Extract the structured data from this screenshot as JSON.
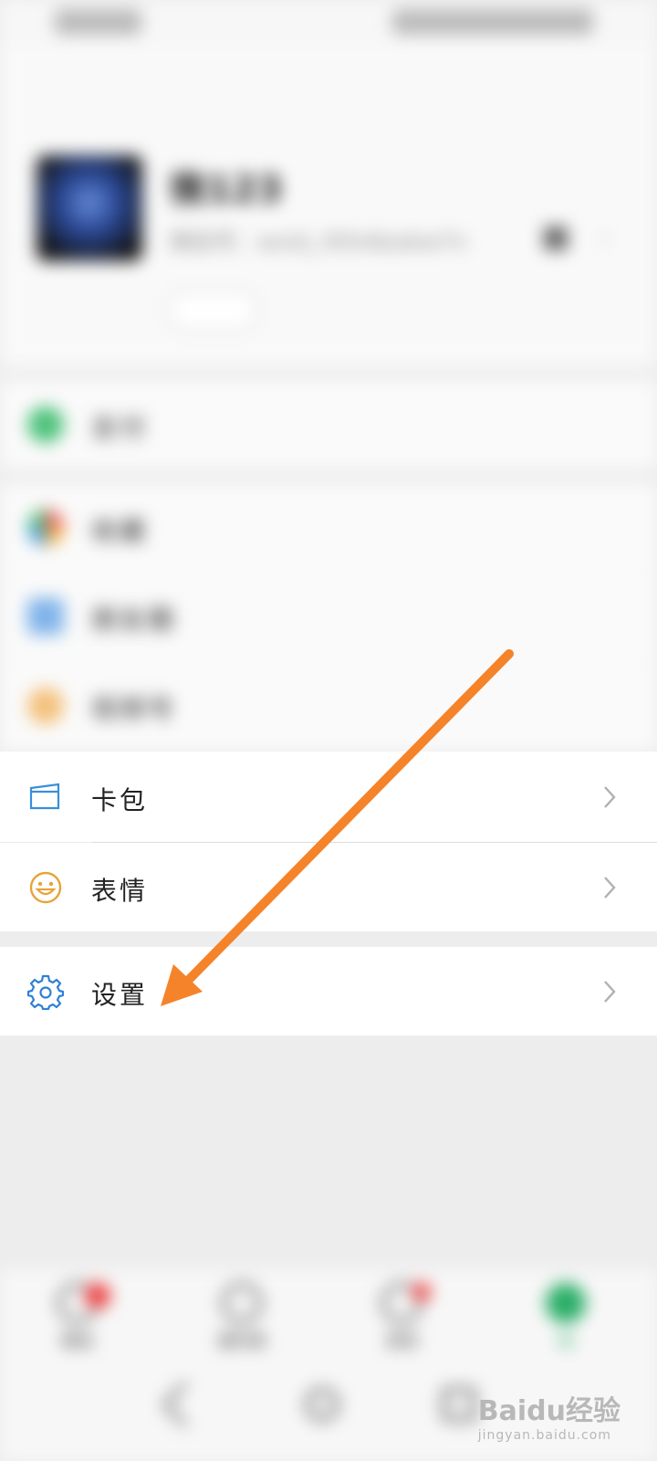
{
  "profile": {
    "nickname": "微123",
    "wechat_id": "微信号：wxid_r93n6zokw7n"
  },
  "menu": {
    "pay": "支付",
    "favorites": "收藏",
    "moments": "朋友圈",
    "channels": "视频号",
    "cards": "卡包",
    "stickers": "表情",
    "settings": "设置"
  },
  "bottom_nav": {
    "chats": "微信",
    "contacts": "通讯录",
    "discover": "发现",
    "me": "我"
  },
  "watermark": {
    "brand": "Baidu经验",
    "url": "jingyan.baidu.com"
  },
  "colors": {
    "arrow": "#f5832a",
    "settings_icon": "#2f7fd6",
    "stickers_icon": "#e8a33a",
    "cards_icon": "#3a8fd8"
  },
  "icons": {
    "cards": "card-wallet-icon",
    "stickers": "smiley-icon",
    "settings": "gear-icon",
    "chevron": "chevron-right-icon"
  }
}
